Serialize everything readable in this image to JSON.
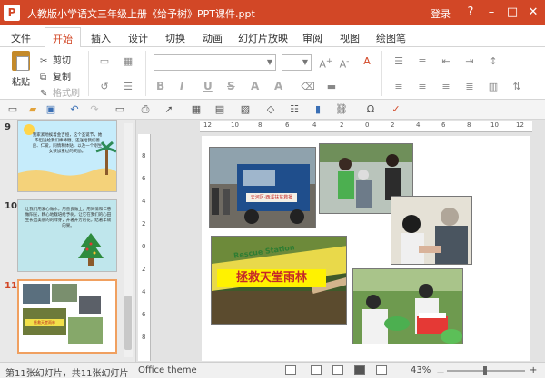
{
  "window": {
    "app_icon_letter": "P",
    "title": "人教版小学语文三年级上册《给予树》PPT课件.ppt",
    "login_label": "登录",
    "controls": {
      "help": "?",
      "minimize": "–",
      "maximize": "□",
      "close": "✕"
    }
  },
  "ribbon": {
    "tabs": [
      "文件",
      "开始",
      "插入",
      "设计",
      "切换",
      "动画",
      "幻灯片放映",
      "审阅",
      "视图",
      "绘图笔"
    ],
    "active_tab": "开始",
    "paste_label": "粘贴",
    "cut_label": "剪切",
    "copy_label": "复制",
    "format_painter_label": "格式刷",
    "font_name_value": "",
    "font_size_value": "",
    "format_buttons": [
      "B",
      "I",
      "U",
      "S",
      "A",
      "A"
    ]
  },
  "slides": [
    {
      "number": "9",
      "text": "我家紧地挨着金吉娅，这个圣诞节，她不但送给我们棒棒糖，还送给我们善良、仁爱，同情和体贴，以及一个刚生女孩加重过的奖励。"
    },
    {
      "number": "10",
      "text": "让我们用爱心做水，用善良做土，用同情和仁慈做阳光，精心地栽培给予树，让它在我们的心田生长出美丽的的绿芽，开著开芳的花，结著丰硕的果。"
    },
    {
      "number": "11",
      "active": true,
      "banner_text": "拯救天堂雨林"
    }
  ],
  "editor": {
    "ruler_h": [
      "12",
      "10",
      "8",
      "6",
      "4",
      "2",
      "0",
      "2",
      "4",
      "6",
      "8",
      "10",
      "12"
    ],
    "ruler_v": [
      "8",
      "6",
      "4",
      "2",
      "0",
      "2",
      "4",
      "6",
      "8"
    ],
    "banner_text": "拯救天堂雨林",
    "banner_sub": "Rescue Station",
    "truck_sign": "天河区·西溪扶贫救援"
  },
  "statusbar": {
    "slide_info": "第11张幻灯片，共11张幻灯片",
    "theme": "Office theme",
    "zoom": "43%",
    "zoom_minus": "－",
    "zoom_plus": "+"
  },
  "colors": {
    "accent": "#d24726",
    "slide_bg_9": "#c6ecfb",
    "slide_bg_10": "#bfe6ec"
  }
}
